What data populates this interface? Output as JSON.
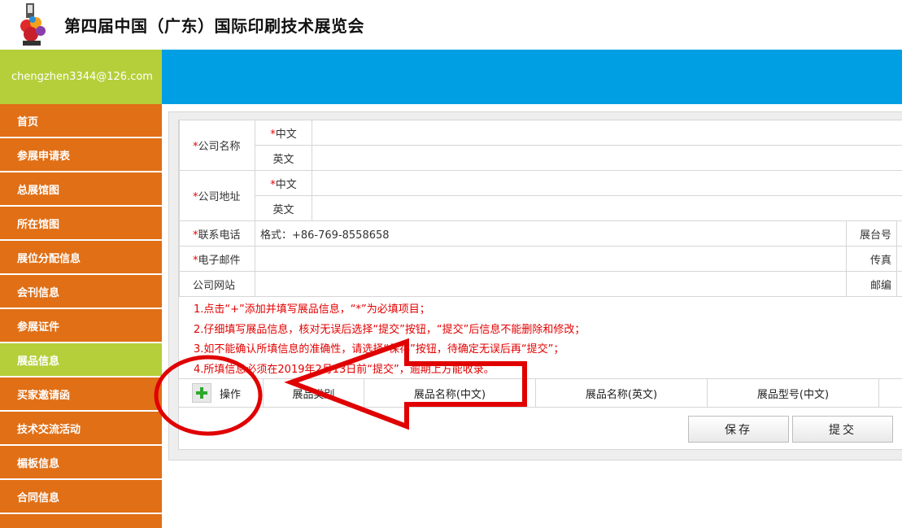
{
  "header": {
    "title": "第四届中国（广东）国际印刷技术展览会"
  },
  "user": {
    "email": "chengzhen3344@126.com"
  },
  "sidebar": {
    "items": [
      {
        "label": "首页"
      },
      {
        "label": "参展申请表"
      },
      {
        "label": "总展馆图"
      },
      {
        "label": "所在馆图"
      },
      {
        "label": "展位分配信息"
      },
      {
        "label": "会刊信息"
      },
      {
        "label": "参展证件"
      },
      {
        "label": "展品信息"
      },
      {
        "label": "买家邀请函"
      },
      {
        "label": "技术交流活动"
      },
      {
        "label": "楣板信息"
      },
      {
        "label": "合同信息"
      }
    ],
    "active_index": 7
  },
  "form": {
    "company_name": {
      "label": "公司名称",
      "cn": "中文",
      "en": "英文"
    },
    "company_address": {
      "label": "公司地址",
      "cn": "中文",
      "en": "英文"
    },
    "phone": {
      "label": "联系电话",
      "placeholder": "格式：+86-769-8558658"
    },
    "booth_no": {
      "label": "展台号"
    },
    "email": {
      "label": "电子邮件"
    },
    "fax": {
      "label": "传真"
    },
    "website": {
      "label": "公司网站"
    },
    "postcode": {
      "label": "邮编"
    },
    "required_mark": "*"
  },
  "notes": [
    "1.点击“+”添加并填写展品信息，“*”为必填项目；",
    "2.仔细填写展品信息，核对无误后选择“提交”按钮，“提交”后信息不能删除和修改；",
    "3.如不能确认所填信息的准确性，请选择“保存”按钮，待确定无误后再“提交”；",
    "4.所填信息必须在2019年2月13日前“提交”，逾期上方能收录。"
  ],
  "products": {
    "columns": [
      "操作",
      "展品类别",
      "展品名称(中文)",
      "展品名称(英文)",
      "展品型号(中文)"
    ]
  },
  "buttons": {
    "save": "保存",
    "submit": "提交"
  },
  "colors": {
    "orange": "#e06f16",
    "green": "#b5cf3a",
    "blue": "#009ee3",
    "annotation_red": "#e00000"
  }
}
